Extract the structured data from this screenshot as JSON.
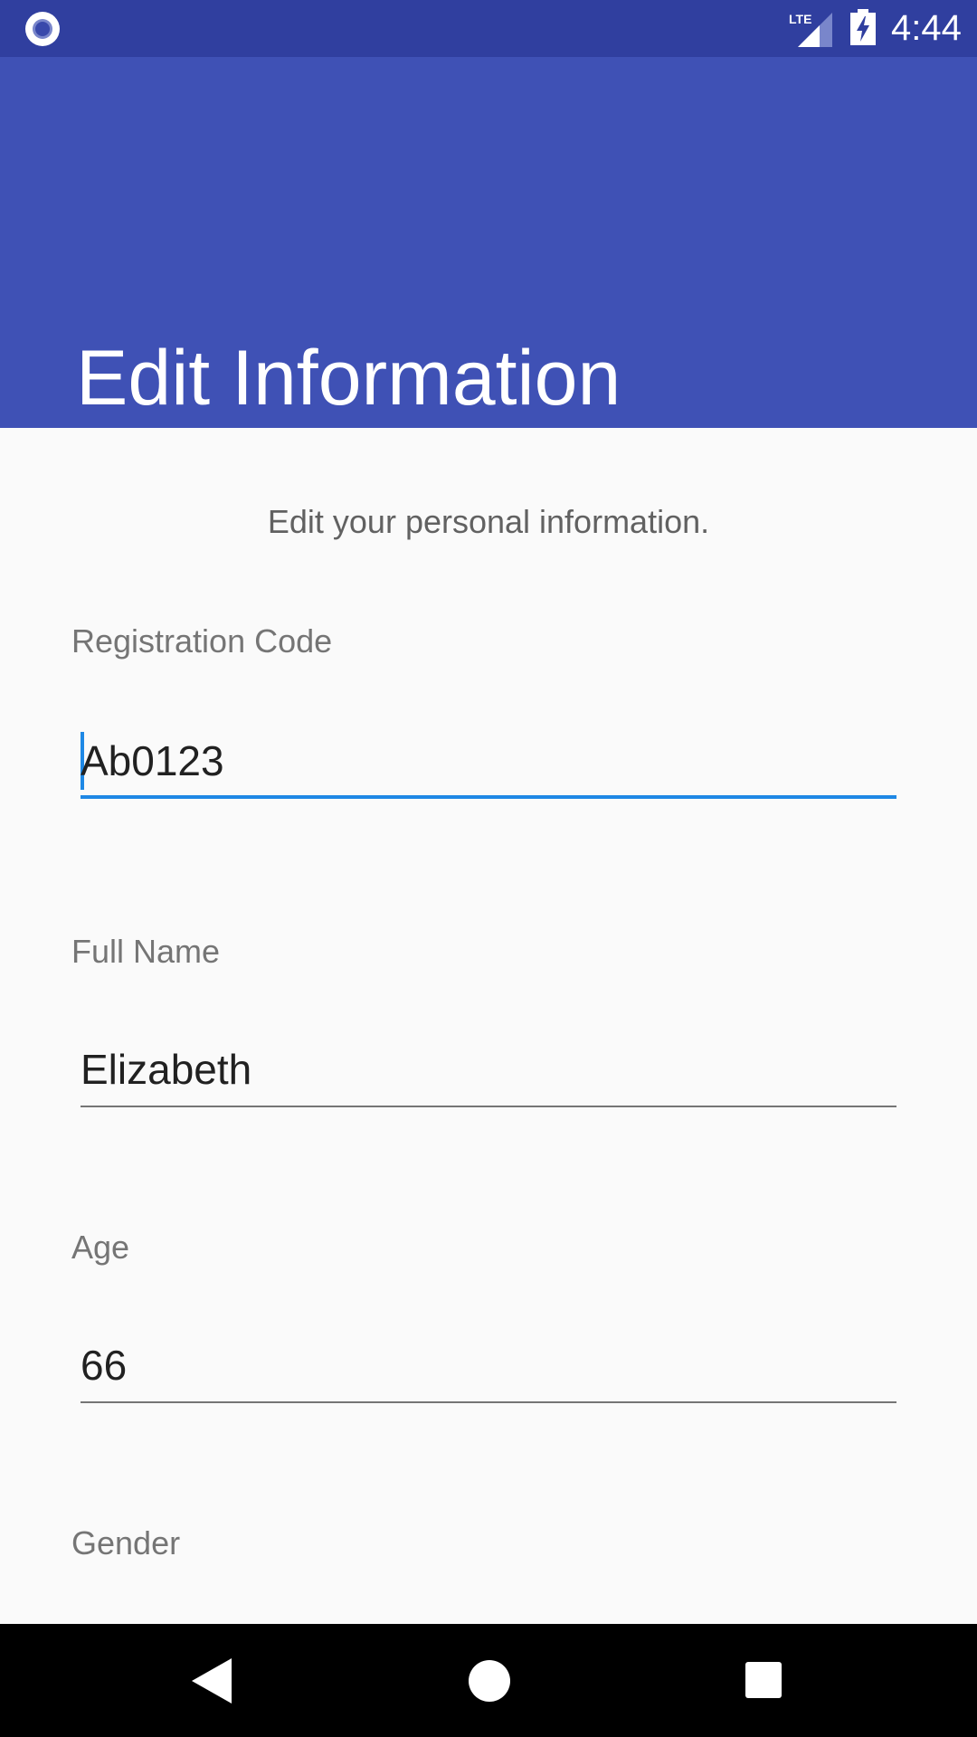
{
  "status_bar": {
    "time": "4:44",
    "network_label": "LTE",
    "icons": [
      "notification-dot-icon",
      "lte-signal-icon",
      "battery-charging-icon"
    ]
  },
  "header": {
    "title": "Edit Information"
  },
  "form": {
    "intro": "Edit your personal information.",
    "fields": [
      {
        "label": "Registration Code",
        "value": "Ab0123"
      },
      {
        "label": "Full Name",
        "value": "Elizabeth"
      },
      {
        "label": "Age",
        "value": "66"
      },
      {
        "label": "Gender",
        "value": ""
      }
    ]
  },
  "nav_bar": {
    "icons": [
      "back-icon",
      "home-icon",
      "recents-icon"
    ]
  },
  "colors": {
    "status_bar": "#303f9f",
    "app_bar": "#3f51b5",
    "accent": "#1e88e5",
    "background": "#fafafa"
  }
}
